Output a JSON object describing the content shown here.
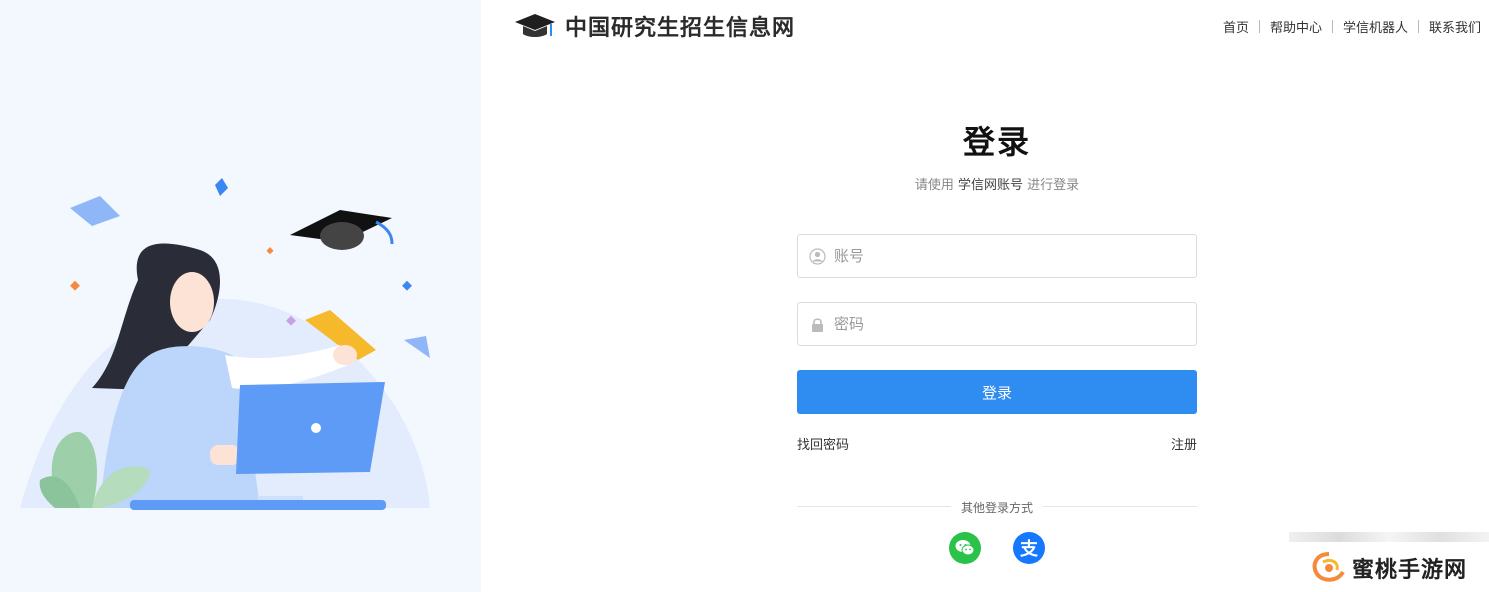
{
  "header": {
    "site_name": "中国研究生招生信息网",
    "nav": [
      "首页",
      "帮助中心",
      "学信机器人",
      "联系我们"
    ]
  },
  "login": {
    "title": "登录",
    "subtitle_prefix": "请使用",
    "subtitle_strong": "学信网账号",
    "subtitle_suffix": "进行登录",
    "account_placeholder": "账号",
    "password_placeholder": "密码",
    "submit_label": "登录",
    "forgot_label": "找回密码",
    "register_label": "注册",
    "other_methods_label": "其他登录方式",
    "social": [
      {
        "name": "wechat-icon",
        "color": "#2bc24a"
      },
      {
        "name": "alipay-icon",
        "color": "#1677ff",
        "glyph": "支"
      }
    ]
  },
  "watermark": {
    "text": "蜜桃手游网"
  },
  "colors": {
    "accent": "#2f8df1",
    "left_bg": "#f3f7fe"
  }
}
